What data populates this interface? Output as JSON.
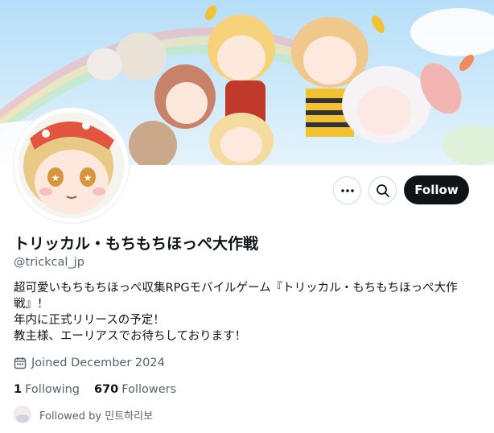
{
  "profile": {
    "display_name": "トリッカル・もちもちほっぺ大作戦",
    "handle": "@trickcal_jp",
    "bio_lines": [
      "超可愛いもちもちほっぺ収集RPGモバイルゲーム『トリッカル・もちもちほっぺ大作",
      "戦』！",
      "年内に正式リリースの予定！",
      "教主様、エーリアスでお待ちしております！"
    ],
    "joined": "Joined December 2024",
    "following_count": "1",
    "following_label": "Following",
    "followers_count": "670",
    "followers_label": "Followers",
    "followed_by": "Followed by 민트하리보"
  },
  "actions": {
    "more_icon": "more-horizontal-icon",
    "search_icon": "search-icon",
    "follow_label": "Follow"
  },
  "colors": {
    "follow_button_bg": "#0f1419",
    "secondary_text": "#536471",
    "border": "#cfd9de"
  }
}
